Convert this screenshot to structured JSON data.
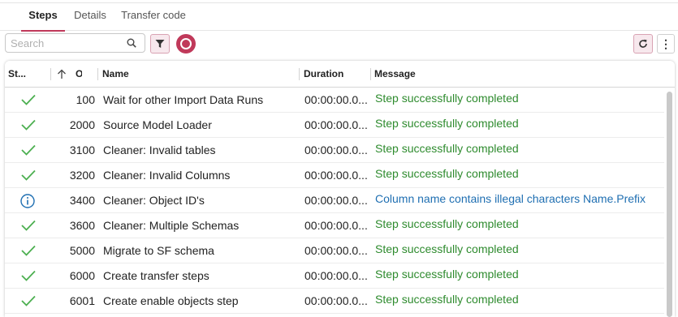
{
  "tabs": [
    {
      "label": "Steps",
      "active": true
    },
    {
      "label": "Details",
      "active": false
    },
    {
      "label": "Transfer code",
      "active": false
    }
  ],
  "toolbar": {
    "search_placeholder": "Search",
    "search_value": ""
  },
  "grid": {
    "columns": {
      "status": "St...",
      "order": "O",
      "name": "Name",
      "duration": "Duration",
      "message": "Message"
    },
    "sort": {
      "column": "order",
      "direction": "ascending"
    },
    "rows": [
      {
        "status": "success",
        "order": "100",
        "name": "Wait for other Import Data Runs",
        "duration": "00:00:00.0...",
        "message": "Step successfully completed"
      },
      {
        "status": "success",
        "order": "2000",
        "name": "Source Model Loader",
        "duration": "00:00:00.0...",
        "message": "Step successfully completed"
      },
      {
        "status": "success",
        "order": "3100",
        "name": "Cleaner: Invalid tables",
        "duration": "00:00:00.0...",
        "message": "Step successfully completed"
      },
      {
        "status": "success",
        "order": "3200",
        "name": "Cleaner: Invalid Columns",
        "duration": "00:00:00.0...",
        "message": "Step successfully completed"
      },
      {
        "status": "info",
        "order": "3400",
        "name": "Cleaner: Object ID's",
        "duration": "00:00:00.0...",
        "message": "Column name contains illegal characters Name.Prefix"
      },
      {
        "status": "success",
        "order": "3600",
        "name": "Cleaner: Multiple Schemas",
        "duration": "00:00:00.0...",
        "message": "Step successfully completed"
      },
      {
        "status": "success",
        "order": "5000",
        "name": "Migrate to SF schema",
        "duration": "00:00:00.0...",
        "message": "Step successfully completed"
      },
      {
        "status": "success",
        "order": "6000",
        "name": "Create transfer steps",
        "duration": "00:00:00.0...",
        "message": "Step successfully completed"
      },
      {
        "status": "success",
        "order": "6001",
        "name": "Create enable objects step",
        "duration": "00:00:00.0...",
        "message": "Step successfully completed"
      }
    ]
  },
  "colors": {
    "accent": "#c0395a",
    "success": "#2e8b2e",
    "info": "#1f6fb2"
  },
  "icons": {
    "search": "search-icon",
    "filter": "filter-icon",
    "record": "record-icon",
    "refresh": "refresh-icon",
    "more": "more-vertical-icon",
    "success": "checkmark-icon",
    "info": "info-icon",
    "sort": "arrow-up-icon"
  }
}
